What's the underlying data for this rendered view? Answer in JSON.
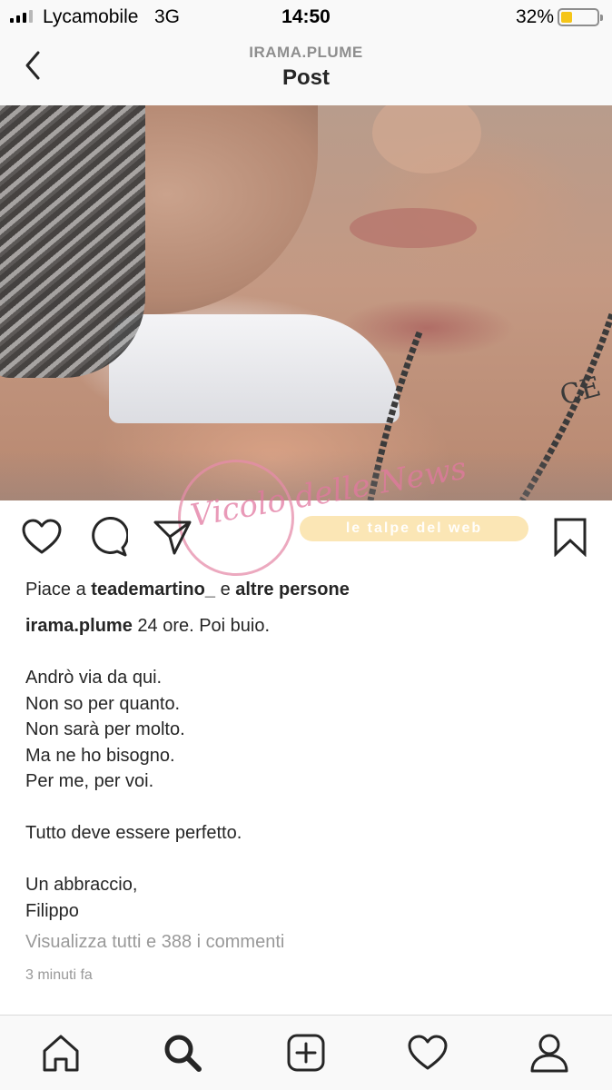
{
  "status_bar": {
    "carrier": "Lycamobile",
    "network": "3G",
    "time": "14:50",
    "battery_percent": "32%",
    "battery_level": 0.32,
    "battery_color": "#f5c518"
  },
  "header": {
    "username": "IRAMA.PLUME",
    "title": "Post",
    "back_icon": "chevron-left-icon"
  },
  "post": {
    "watermark_text": "Vicolo delle News",
    "watermark_badge": "le talpe del web",
    "actions": {
      "like_icon": "heart-icon",
      "comment_icon": "comment-bubble-icon",
      "share_icon": "paper-plane-icon",
      "save_icon": "bookmark-icon"
    },
    "likes": {
      "prefix": "Piace a",
      "first_user": "teademartino_",
      "joiner": "e",
      "others": "altre persone"
    },
    "caption": {
      "username": "irama.plume",
      "first_line": "24 ore. Poi buio.",
      "body": "Andrò via da qui.\nNon so per quanto.\nNon sarà per molto.\nMa ne ho bisogno.\nPer me, per voi.\n\nTutto deve essere perfetto.\n\nUn abbraccio,\nFilippo"
    },
    "view_comments": "Visualizza tutti e 388 i commenti",
    "time_ago": "3 minuti fa"
  },
  "tab_bar": {
    "items": [
      {
        "name": "home",
        "icon": "home-icon"
      },
      {
        "name": "search",
        "icon": "search-icon"
      },
      {
        "name": "new-post",
        "icon": "plus-square-icon"
      },
      {
        "name": "activity",
        "icon": "heart-icon"
      },
      {
        "name": "profile",
        "icon": "user-icon"
      }
    ]
  }
}
